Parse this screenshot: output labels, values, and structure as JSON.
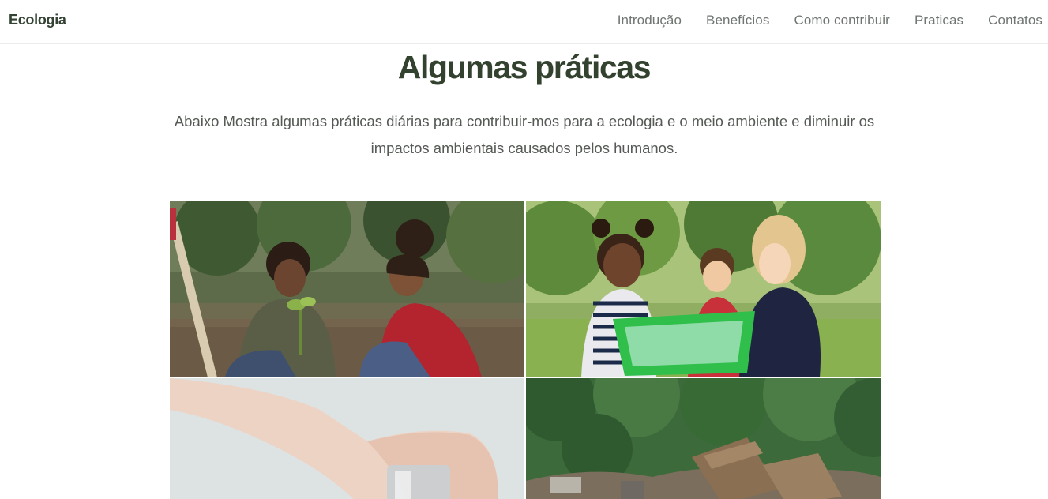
{
  "navbar": {
    "brand": "Ecologia",
    "links": [
      {
        "label": "Introdução"
      },
      {
        "label": "Benefícios"
      },
      {
        "label": "Como contribuir"
      },
      {
        "label": "Praticas"
      },
      {
        "label": "Contatos"
      }
    ]
  },
  "section": {
    "title": "Algumas práticas",
    "description": "Abaixo Mostra algumas práticas diárias para contribuir-mos para a ecologia e o meio ambiente e diminuir os impactos ambientais causados pelos humanos."
  }
}
